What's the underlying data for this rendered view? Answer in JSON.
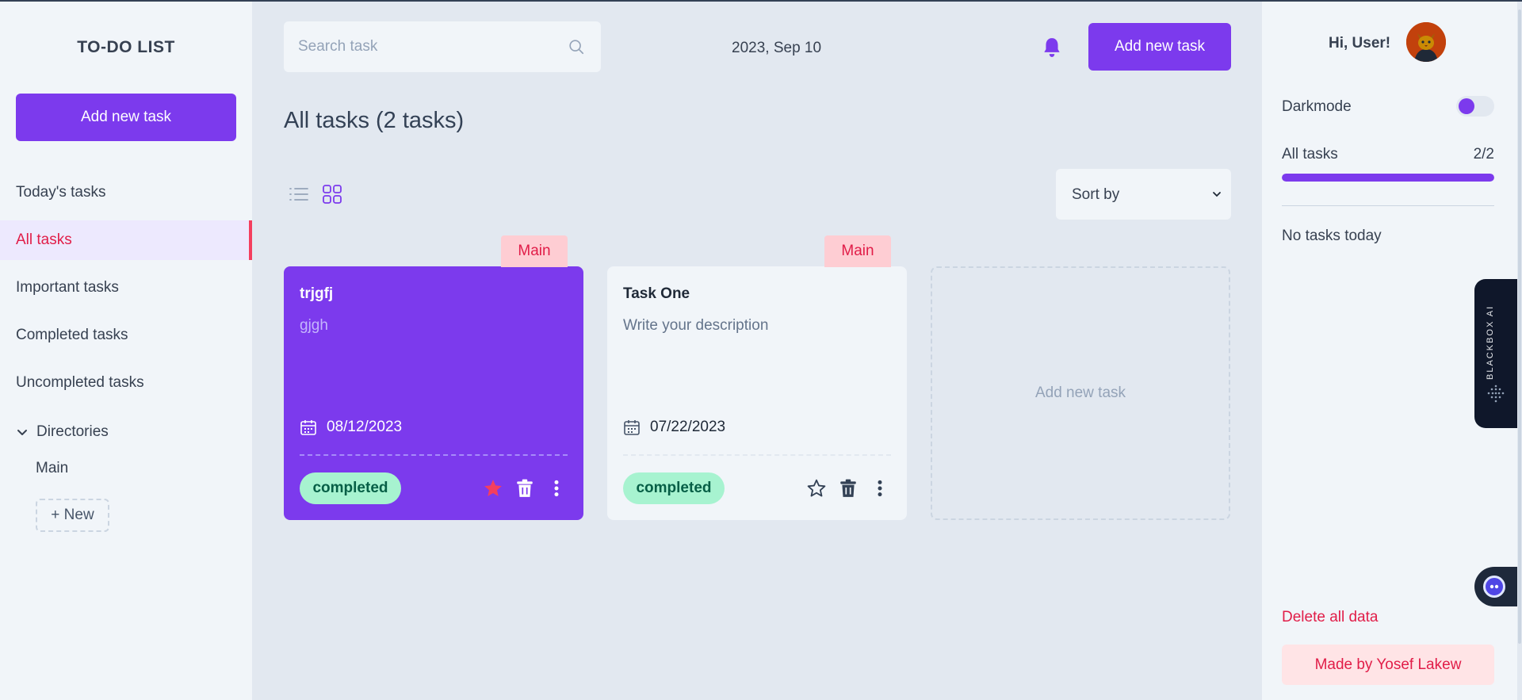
{
  "sidebar": {
    "brand": "TO-DO LIST",
    "add_button": "Add new task",
    "nav": [
      {
        "label": "Today's tasks",
        "active": false
      },
      {
        "label": "All tasks",
        "active": true
      },
      {
        "label": "Important tasks",
        "active": false
      },
      {
        "label": "Completed tasks",
        "active": false
      },
      {
        "label": "Uncompleted tasks",
        "active": false
      }
    ],
    "directories": {
      "label": "Directories",
      "items": [
        "Main"
      ],
      "new_button": "+ New"
    }
  },
  "header": {
    "search_placeholder": "Search task",
    "date": "2023, Sep 10",
    "add_button": "Add new task"
  },
  "main": {
    "title": "All tasks (2 tasks)",
    "sort_label": "Sort by",
    "cards": [
      {
        "directory": "Main",
        "title": "trjgfj",
        "description": "gjgh",
        "date": "08/12/2023",
        "status": "completed",
        "important": true
      },
      {
        "directory": "Main",
        "title": "Task One",
        "description": "Write your description",
        "date": "07/22/2023",
        "status": "completed",
        "important": false
      }
    ],
    "add_card_label": "Add new task"
  },
  "right_panel": {
    "greeting": "Hi, User!",
    "darkmode_label": "Darkmode",
    "darkmode_on": false,
    "progress_label": "All tasks",
    "progress_count": "2/2",
    "progress_fraction": 1.0,
    "no_tasks": "No tasks today",
    "delete_all": "Delete all data",
    "made_by": "Made by Yosef Lakew"
  },
  "widget": {
    "label": "BLACKBOX AI"
  },
  "colors": {
    "accent": "#7c3aed",
    "danger": "#e11d48",
    "status_completed": "#a7f3d0"
  }
}
